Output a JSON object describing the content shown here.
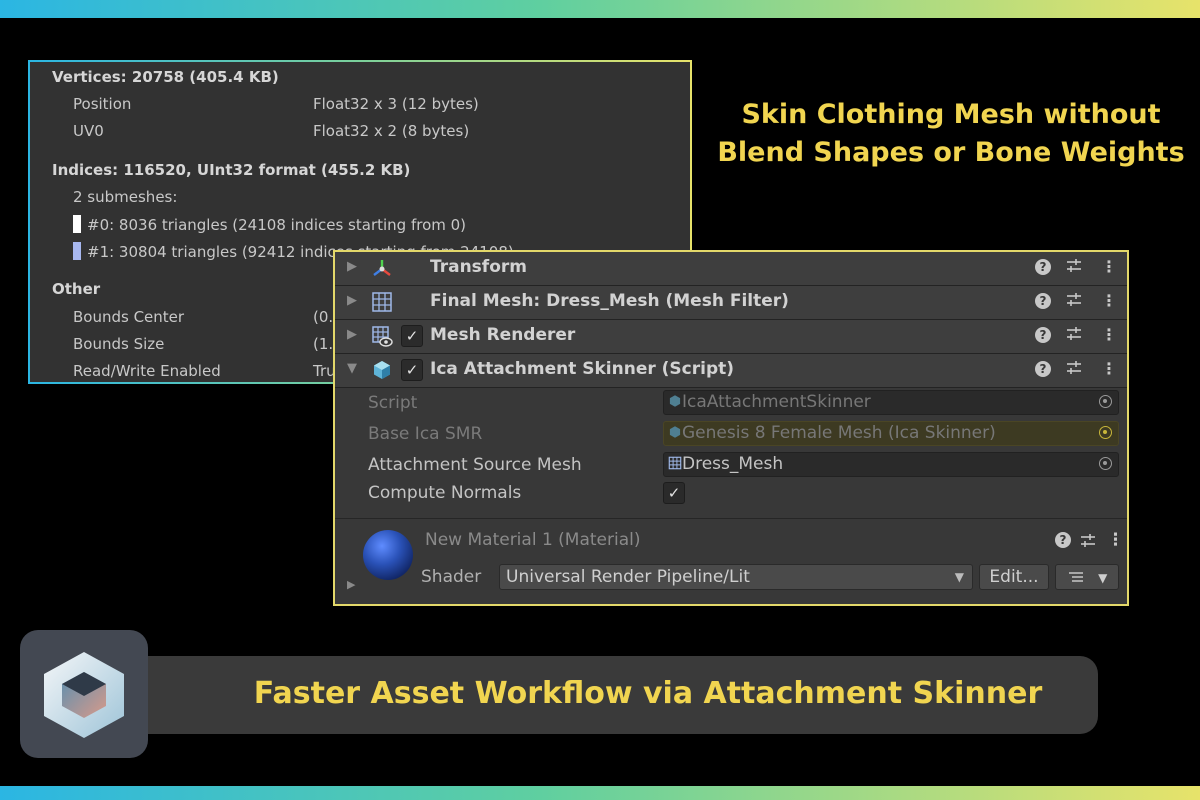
{
  "mesh_info": {
    "vertices_header": "Vertices: 20758 (405.4 KB)",
    "attributes": [
      {
        "name": "Position",
        "format": "Float32 x 3 (12 bytes)"
      },
      {
        "name": "UV0",
        "format": "Float32 x 2 (8 bytes)"
      }
    ],
    "indices_header": "Indices: 116520, UInt32 format (455.2 KB)",
    "submeshes_label": "2 submeshes:",
    "submeshes": [
      {
        "label": "#0: 8036 triangles (24108 indices starting from 0)",
        "color": "#ffffff"
      },
      {
        "label": "#1: 30804 triangles (92412 indices starting from 24108)",
        "color": "#a8b8f0"
      }
    ],
    "other_header": "Other",
    "other": [
      {
        "name": "Bounds Center",
        "value": "(0."
      },
      {
        "name": "Bounds Size",
        "value": "(1."
      },
      {
        "name": "Read/Write Enabled",
        "value": "Tru"
      }
    ]
  },
  "inspector": {
    "components": [
      {
        "title": "Transform",
        "icon": "transform-icon"
      },
      {
        "title": "Final Mesh: Dress_Mesh (Mesh Filter)",
        "icon": "mesh-filter-icon"
      },
      {
        "title": "Mesh Renderer",
        "icon": "mesh-renderer-icon",
        "enabled": true
      },
      {
        "title": "Ica Attachment Skinner (Script)",
        "icon": "script-icon",
        "enabled": true
      }
    ],
    "properties": {
      "script_label": "Script",
      "script_value": "IcaAttachmentSkinner",
      "base_label": "Base Ica SMR",
      "base_value": "Genesis 8 Female Mesh (Ica Skinner)",
      "source_label": "Attachment Source Mesh",
      "source_value": "Dress_Mesh",
      "normals_label": "Compute Normals",
      "normals_checked": true
    },
    "material": {
      "title": "New Material 1 (Material)",
      "shader_label": "Shader",
      "shader_value": "Universal Render Pipeline/Lit",
      "edit_label": "Edit..."
    },
    "glyphs": {
      "help": "?",
      "check": "✓",
      "kebab": "⋮",
      "fold_closed": "▶",
      "fold_open": "▼"
    }
  },
  "headline": {
    "line1": "Skin Clothing Mesh without",
    "line2": "Blend Shapes or Bone Weights"
  },
  "banner": {
    "text": "Faster Asset Workflow via Attachment Skinner"
  },
  "colors": {
    "accent_yellow": "#f1d550",
    "gradient_start": "#2bb6e3",
    "gradient_end": "#e7e36a"
  }
}
